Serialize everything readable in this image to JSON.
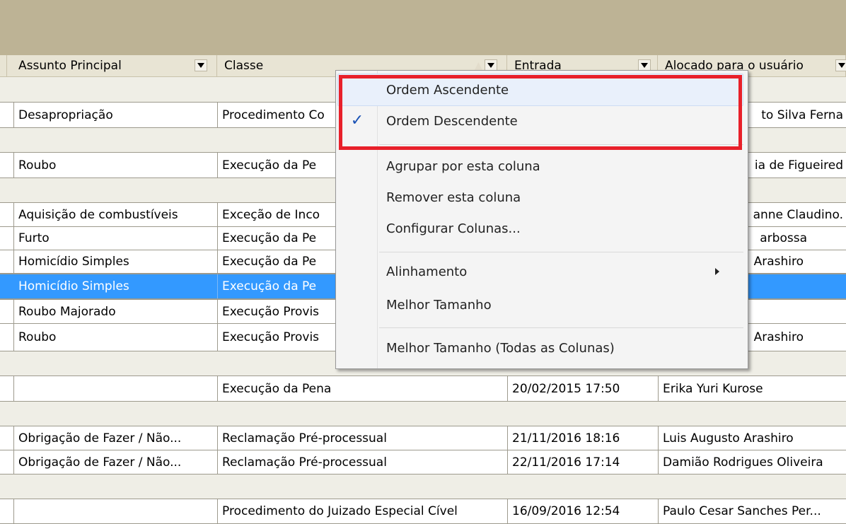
{
  "header": {
    "columns": [
      "Assunto Principal",
      "Classe",
      "Entrada",
      "Alocado para o usuário"
    ]
  },
  "rows": [
    {
      "assunto": "Desapropriação",
      "classe": "Procedimento Co",
      "entrada": "",
      "usuario": "to Silva Ferna"
    },
    {
      "assunto": "Roubo",
      "classe": "Execução da Pe",
      "entrada": "",
      "usuario": "ia de Figueired"
    },
    {
      "assunto": "Aquisição de combustíveis",
      "classe": "Exceção de Inco",
      "entrada": "",
      "usuario": "anne Claudino."
    },
    {
      "assunto": "Furto",
      "classe": "Execução da Pe",
      "entrada": "",
      "usuario": "arbossa"
    },
    {
      "assunto": "Homicídio Simples",
      "classe": "Execução da Pe",
      "entrada": "",
      "usuario": "Arashiro"
    },
    {
      "assunto": "Homicídio Simples",
      "classe": "Execução da Pe",
      "entrada": "",
      "usuario": ""
    },
    {
      "assunto": "Roubo Majorado",
      "classe": "Execução Provis",
      "entrada": "",
      "usuario": ""
    },
    {
      "assunto": "Roubo",
      "classe": "Execução Provis",
      "entrada": "",
      "usuario": "Arashiro"
    },
    {
      "assunto": "",
      "classe": "Execução da Pena",
      "entrada": "20/02/2015 17:50",
      "usuario": "Erika Yuri Kurose"
    },
    {
      "assunto": "Obrigação de Fazer / Não...",
      "classe": "Reclamação Pré-processual",
      "entrada": "21/11/2016 18:16",
      "usuario": "Luis Augusto Arashiro"
    },
    {
      "assunto": "Obrigação de Fazer / Não...",
      "classe": "Reclamação Pré-processual",
      "entrada": "22/11/2016 17:14",
      "usuario": "Damião Rodrigues Oliveira"
    },
    {
      "assunto": "",
      "classe": "Procedimento do Juizado Especial Cível",
      "entrada": "16/09/2016 12:54",
      "usuario": "Paulo Cesar Sanches Per..."
    }
  ],
  "context_menu": {
    "items": [
      {
        "label": "Ordem Ascendente"
      },
      {
        "label": "Ordem Descendente",
        "checked": true
      },
      {
        "label": "Agrupar por esta coluna"
      },
      {
        "label": "Remover esta coluna"
      },
      {
        "label": "Configurar Colunas..."
      },
      {
        "label": "Alinhamento",
        "submenu": true
      },
      {
        "label": "Melhor Tamanho"
      },
      {
        "label": "Melhor Tamanho (Todas as Colunas)"
      }
    ]
  },
  "colors": {
    "top_band": "#bdb395",
    "header_bg": "#e8e4d4",
    "selection": "#3399ff",
    "highlight_box": "#e8202a"
  }
}
